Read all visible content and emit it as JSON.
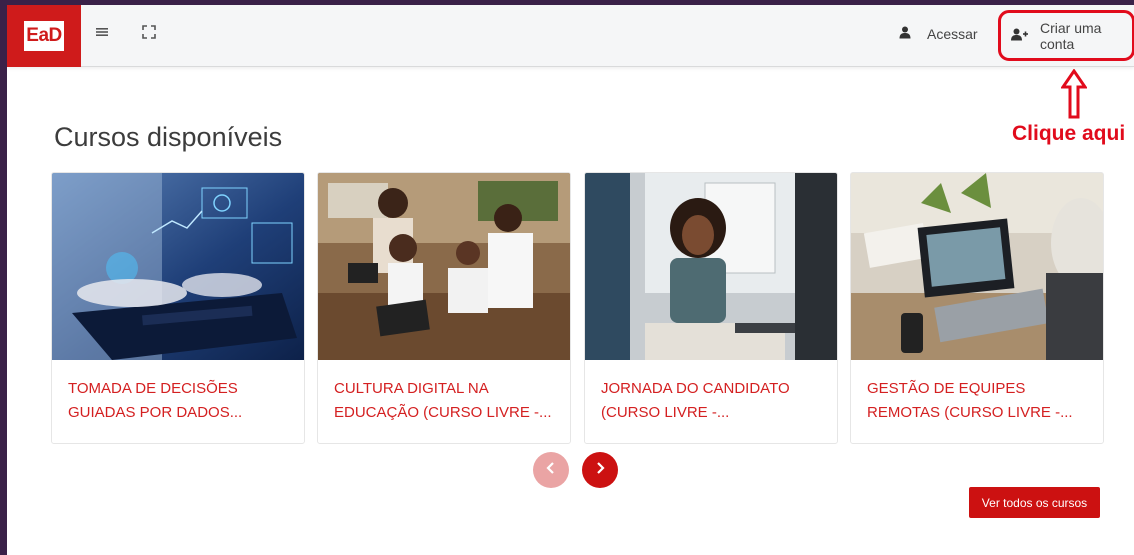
{
  "header": {
    "logo_text": "EaD",
    "login_label": "Acessar",
    "signup_label": "Criar uma conta"
  },
  "annotation": {
    "text": "Clique aqui",
    "color": "#e10b1c"
  },
  "main": {
    "title": "Cursos disponíveis",
    "courses": [
      {
        "title": "TOMADA DE DECISÕES GUIADAS POR DADOS...",
        "image": "data-dashboard-laptop"
      },
      {
        "title": "CULTURA DIGITAL NA EDUCAÇÃO (CURSO LIVRE -...",
        "image": "students-with-tablets"
      },
      {
        "title": "JORNADA DO CANDIDATO (CURSO LIVRE -...",
        "image": "job-interview"
      },
      {
        "title": "GESTÃO DE EQUIPES REMOTAS (CURSO LIVRE -...",
        "image": "video-call-laptop"
      }
    ],
    "view_all_label": "Ver todos os cursos"
  },
  "icons": {
    "menu": "menu-icon",
    "fullscreen": "expand-icon",
    "login": "user-icon",
    "signup": "user-plus-icon",
    "prev": "chevron-left-icon",
    "next": "chevron-right-icon"
  },
  "colors": {
    "brand": "#cf1b1b",
    "accent": "#cc1111",
    "course_title": "#d42021",
    "frame_border": "#3a2148"
  }
}
